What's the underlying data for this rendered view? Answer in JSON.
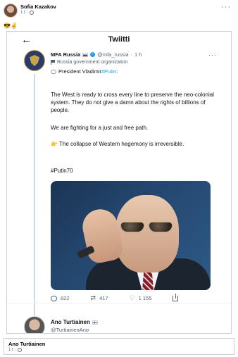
{
  "fb_post": {
    "author": "Sofia Kazakov",
    "time": "1 t",
    "separator": "·",
    "emojis": "😎✌️",
    "more": "···"
  },
  "twitter": {
    "title": "Twiitti",
    "tweet": {
      "name": "MFA Russia",
      "handle": "@mfa_russia",
      "time": "1 h",
      "separator": "·",
      "org_label": "Russia government organization",
      "line1_prefix": "President Vladimir ",
      "line1_hashtag": "#Putin",
      "line1_suffix": ":",
      "para1": "The West is ready to cross every line to preserve the neo-colonial system. They do not give a damn about the rights of billions of people.",
      "para2": "We are fighting for a just and free path.",
      "para3_emoji": "👉",
      "para3": "The collapse of Western hegemony is irreversible.",
      "hashtag": "#Putin70",
      "replies": "822",
      "retweets": "417",
      "likes": "1 155",
      "more": "···"
    },
    "next_account": {
      "name": "Ano Turtiainen",
      "handle": "@TurtiainenAno"
    }
  },
  "caption": {
    "name": "Ano Turtiainen",
    "time": "1 t",
    "separator": "·"
  },
  "colors": {
    "link_blue": "#1d9bf0",
    "secondary_text": "#536471"
  }
}
